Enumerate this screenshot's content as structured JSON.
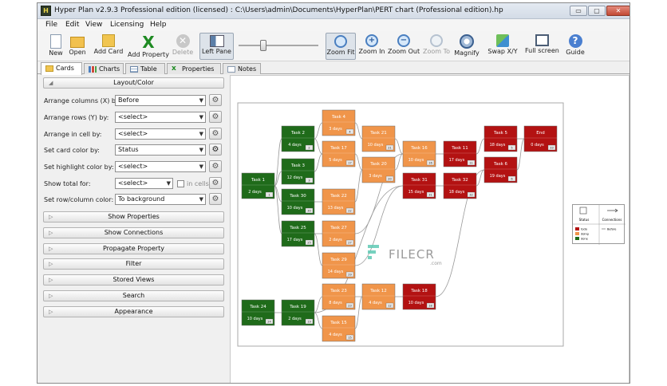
{
  "window": {
    "title": "Hyper Plan v2.9.3 Professional edition (licensed) : C:\\Users\\admin\\Documents\\HyperPlan\\PERT chart (Professional edition).hp",
    "app_icon_letter": "H",
    "buttons": {
      "minimize": "▭",
      "maximize": "▢",
      "close": "✕"
    }
  },
  "menu": [
    "File",
    "Edit",
    "View",
    "Licensing",
    "Help"
  ],
  "toolbar": [
    {
      "label": "New",
      "icon": "new-document-icon"
    },
    {
      "label": "Open",
      "icon": "folder-icon"
    },
    {
      "label": "Add Card",
      "icon": "card-icon"
    },
    {
      "label": "Add Property",
      "icon": "add-property-icon"
    },
    {
      "label": "Delete",
      "icon": "delete-icon",
      "disabled": true
    },
    {
      "label": "Left Pane",
      "icon": "left-pane-icon",
      "pressed": true
    },
    {
      "label": "Zoom Fit",
      "icon": "zoom-fit-icon",
      "pressed": true
    },
    {
      "label": "Zoom In",
      "icon": "zoom-in-icon"
    },
    {
      "label": "Zoom Out",
      "icon": "zoom-out-icon"
    },
    {
      "label": "Zoom To",
      "icon": "zoom-to-icon",
      "disabled": true
    },
    {
      "label": "Magnify",
      "icon": "magnify-icon"
    },
    {
      "label": "Swap X/Y",
      "icon": "swap-icon"
    },
    {
      "label": "Full screen",
      "icon": "full-screen-icon"
    },
    {
      "label": "Guide",
      "icon": "help-icon"
    }
  ],
  "tabs": [
    {
      "label": "Cards",
      "active": true
    },
    {
      "label": "Charts"
    },
    {
      "label": "Table"
    },
    {
      "label": "Properties"
    },
    {
      "label": "Notes"
    }
  ],
  "left_pane": {
    "layout_section": "Layout/Color",
    "rows": [
      {
        "label": "Arrange columns (X) by:",
        "value": "Before"
      },
      {
        "label": "Arrange rows (Y) by:",
        "value": "<select>"
      },
      {
        "label": "Arrange in cell by:",
        "value": "<select>"
      },
      {
        "label": "Set card color by:",
        "value": "Status"
      },
      {
        "label": "Set highlight color by:",
        "value": "<select>"
      },
      {
        "label": "Show total for:",
        "value": "<select>"
      },
      {
        "label": "Set row/column color:",
        "value": "To background"
      }
    ],
    "in_cells_label": "in cells",
    "sections": [
      "Show Properties",
      "Show Connections",
      "Propagate Property",
      "Filter",
      "Stored Views",
      "Search",
      "Appearance"
    ]
  },
  "chart": {
    "cards": [
      {
        "name": "Task 1",
        "duration": "2 days",
        "status": "done",
        "badge": "1"
      },
      {
        "name": "Task 2",
        "duration": "4 days",
        "status": "done",
        "badge": "2"
      },
      {
        "name": "Task 3",
        "duration": "12 days",
        "status": "done",
        "badge": "3"
      },
      {
        "name": "Task 30",
        "duration": "10 days",
        "status": "done",
        "badge": "30"
      },
      {
        "name": "Task 25",
        "duration": "17 days",
        "status": "done",
        "badge": "25"
      },
      {
        "name": "Task 24",
        "duration": "10 days",
        "status": "done",
        "badge": "24"
      },
      {
        "name": "Task 19",
        "duration": "2 days",
        "status": "done",
        "badge": "19"
      },
      {
        "name": "Task 4",
        "duration": "3 days",
        "status": "doing",
        "badge": "4"
      },
      {
        "name": "Task 17",
        "duration": "5 days",
        "status": "doing",
        "badge": "17"
      },
      {
        "name": "Task 22",
        "duration": "13 days",
        "status": "doing",
        "badge": "22"
      },
      {
        "name": "Task 27",
        "duration": "2 days",
        "status": "doing",
        "badge": "27"
      },
      {
        "name": "Task 29",
        "duration": "14 days",
        "status": "doing",
        "badge": "29"
      },
      {
        "name": "Task 23",
        "duration": "8 days",
        "status": "doing",
        "badge": "23"
      },
      {
        "name": "Task 15",
        "duration": "4 days",
        "status": "doing",
        "badge": "15"
      },
      {
        "name": "Task 21",
        "duration": "10 days",
        "status": "doing",
        "badge": "21"
      },
      {
        "name": "Task 20",
        "duration": "3 days",
        "status": "doing",
        "badge": "20"
      },
      {
        "name": "Task 12",
        "duration": "4 days",
        "status": "doing",
        "badge": "12"
      },
      {
        "name": "Task 16",
        "duration": "10 days",
        "status": "doing",
        "badge": "16"
      },
      {
        "name": "Task 31",
        "duration": "15 days",
        "status": "todo",
        "badge": "31"
      },
      {
        "name": "Task 18",
        "duration": "10 days",
        "status": "todo",
        "badge": "18"
      },
      {
        "name": "Task 11",
        "duration": "17 days",
        "status": "todo",
        "badge": "11"
      },
      {
        "name": "Task 32",
        "duration": "18 days",
        "status": "todo",
        "badge": "32"
      },
      {
        "name": "Task 5",
        "duration": "18 days",
        "status": "todo",
        "badge": "5"
      },
      {
        "name": "Task 6",
        "duration": "19 days",
        "status": "todo",
        "badge": "6"
      },
      {
        "name": "End",
        "duration": "0 days",
        "status": "todo",
        "badge": "33"
      }
    ],
    "status_colors": {
      "done": "#1f6b1a",
      "doing": "#f0954a",
      "todo": "#b31212"
    },
    "legend": {
      "status_title": "Status",
      "connections_title": "Connections",
      "statuses": [
        "todo",
        "doing",
        "done"
      ],
      "connection_label": "Before"
    }
  },
  "watermark": {
    "brand": "FILECR",
    "suffix": ".com"
  }
}
